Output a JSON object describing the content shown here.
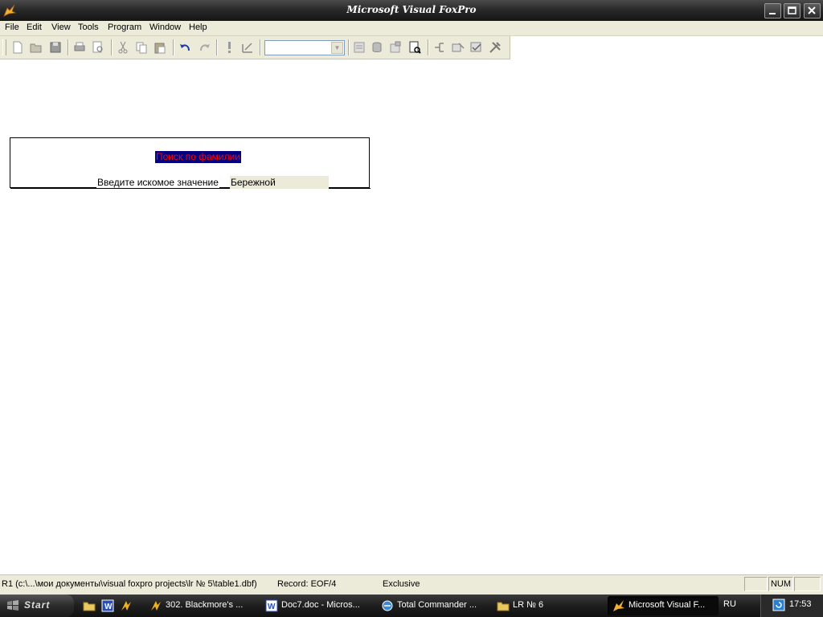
{
  "window": {
    "title": "Microsoft Visual FoxPro"
  },
  "menu": {
    "items": [
      "File",
      "Edit",
      "View",
      "Tools",
      "Program",
      "Window",
      "Help"
    ]
  },
  "toolbar": {
    "combo_value": ""
  },
  "form": {
    "title": "Поиск по фамилии",
    "label": "Введите искомое значение",
    "input_value": "Бережной"
  },
  "status": {
    "path": "R1 (c:\\...\\мои документы\\visual foxpro projects\\lr № 5\\table1.dbf)",
    "record": "Record: EOF/4",
    "mode": "Exclusive",
    "num": "NUM"
  },
  "taskbar": {
    "start_label": "Start",
    "tasks": [
      {
        "label": "302. Blackmore's ...",
        "icon": "winamp-icon"
      },
      {
        "label": "Doc7.doc - Micros...",
        "icon": "word-icon"
      },
      {
        "label": "Total Commander ...",
        "icon": "total-commander-icon"
      },
      {
        "label": "LR № 6",
        "icon": "folder-icon"
      },
      {
        "label": "Microsoft Visual F...",
        "icon": "foxpro-icon"
      }
    ],
    "language": "RU",
    "clock": "17:53"
  },
  "colors": {
    "form_title_bg": "#000080",
    "form_title_fg": "#ff0000",
    "chrome": "#ecead9"
  }
}
